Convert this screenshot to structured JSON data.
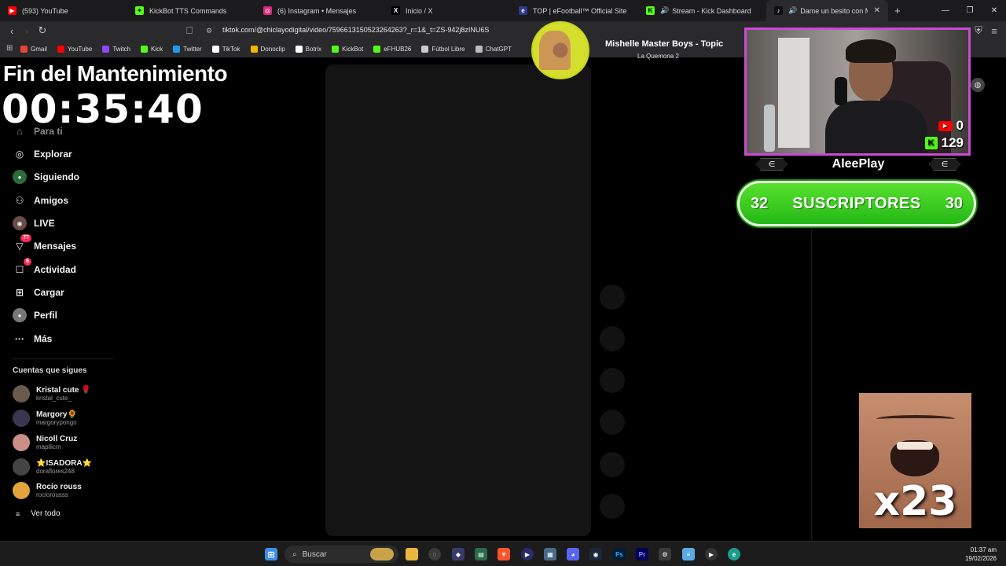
{
  "tabs": [
    {
      "label": "(593) YouTube",
      "color": "#ff0000",
      "glyph": "▶"
    },
    {
      "label": "KickBot TTS Commands",
      "color": "#53fc18",
      "glyph": "✦"
    },
    {
      "label": "(6) Instagram • Mensajes",
      "color": "#d62976",
      "glyph": "◎"
    },
    {
      "label": "Inicio / X",
      "color": "#000000",
      "glyph": "X"
    },
    {
      "label": "TOP | eFootball™ Official Site",
      "color": "#2d3a8c",
      "glyph": "e"
    },
    {
      "label": "Stream - Kick Dashboard",
      "color": "#53fc18",
      "glyph": "K"
    },
    {
      "label": "Dame un besito con Macke",
      "color": "#111111",
      "glyph": "♪"
    }
  ],
  "browser": {
    "url": "tiktok.com/@chiclayodigital/video/7596613150523264263?_r=1&_t=ZS-942j8zINU6S"
  },
  "bookmarks": [
    {
      "label": "Gmail",
      "color": "#ea4335"
    },
    {
      "label": "YouTube",
      "color": "#ff0000"
    },
    {
      "label": "Twitch",
      "color": "#9146ff"
    },
    {
      "label": "Kick",
      "color": "#53fc18"
    },
    {
      "label": "Twitter",
      "color": "#1d9bf0"
    },
    {
      "label": "TikTok",
      "color": "#ffffff"
    },
    {
      "label": "Donoclip",
      "color": "#f5b400"
    },
    {
      "label": "Botrix",
      "color": "#ffffff"
    },
    {
      "label": "KickBot",
      "color": "#53fc18"
    },
    {
      "label": "eFHUB26",
      "color": "#53fc18"
    },
    {
      "label": "Fútbol Libre",
      "color": "#cccccc"
    },
    {
      "label": "ChatGPT",
      "color": "#bbbbbb"
    }
  ],
  "overlay": {
    "title": "Fin del Mantenimiento",
    "timer": "00:35:40"
  },
  "sidebar": {
    "items": [
      {
        "label": "Para ti",
        "icon": "home-icon",
        "glyph": "⌂"
      },
      {
        "label": "Explorar",
        "icon": "compass-icon",
        "glyph": "◎"
      },
      {
        "label": "Siguiendo",
        "icon": "following-icon",
        "glyph": "●"
      },
      {
        "label": "Amigos",
        "icon": "friends-icon",
        "glyph": "⚇"
      },
      {
        "label": "LIVE",
        "icon": "live-icon",
        "glyph": "◉"
      },
      {
        "label": "Mensajes",
        "icon": "messages-icon",
        "glyph": "▽",
        "badge": "77"
      },
      {
        "label": "Actividad",
        "icon": "activity-icon",
        "glyph": "☐",
        "badge": "6"
      },
      {
        "label": "Cargar",
        "icon": "upload-icon",
        "glyph": "⊞"
      },
      {
        "label": "Perfil",
        "icon": "profile-icon",
        "glyph": "●"
      },
      {
        "label": "Más",
        "icon": "more-icon",
        "glyph": "···"
      }
    ],
    "following_title": "Cuentas que sigues",
    "accounts": [
      {
        "name": "Kristal cute 🌹",
        "user": "kristal_cute_",
        "color": "#6b5a4c"
      },
      {
        "name": "Margory🌻",
        "user": "margorypongo",
        "color": "#3b3650"
      },
      {
        "name": "Nicoll Cruz",
        "user": "mapliicm",
        "color": "#c98f86"
      },
      {
        "name": "⭐ISADORA⭐",
        "user": "doraflores248",
        "color": "#444444"
      },
      {
        "name": "Rocío rouss",
        "user": "rociorousss",
        "color": "#e2a43a"
      }
    ],
    "see_all": "Ver todo"
  },
  "music": {
    "song": "Mishelle Master Boys - Topic",
    "artist": "La Quemona 2"
  },
  "stream": {
    "youtube_count": "0",
    "kick_count": "129",
    "streamer": "AleePlay",
    "subs_left": "32",
    "subs_label": "SUSCRIPTORES",
    "subs_right": "30"
  },
  "meme": {
    "multiplier": "x23"
  },
  "taskbar": {
    "search": "Buscar",
    "time": "01:37 am",
    "date": "19/02/2026"
  }
}
